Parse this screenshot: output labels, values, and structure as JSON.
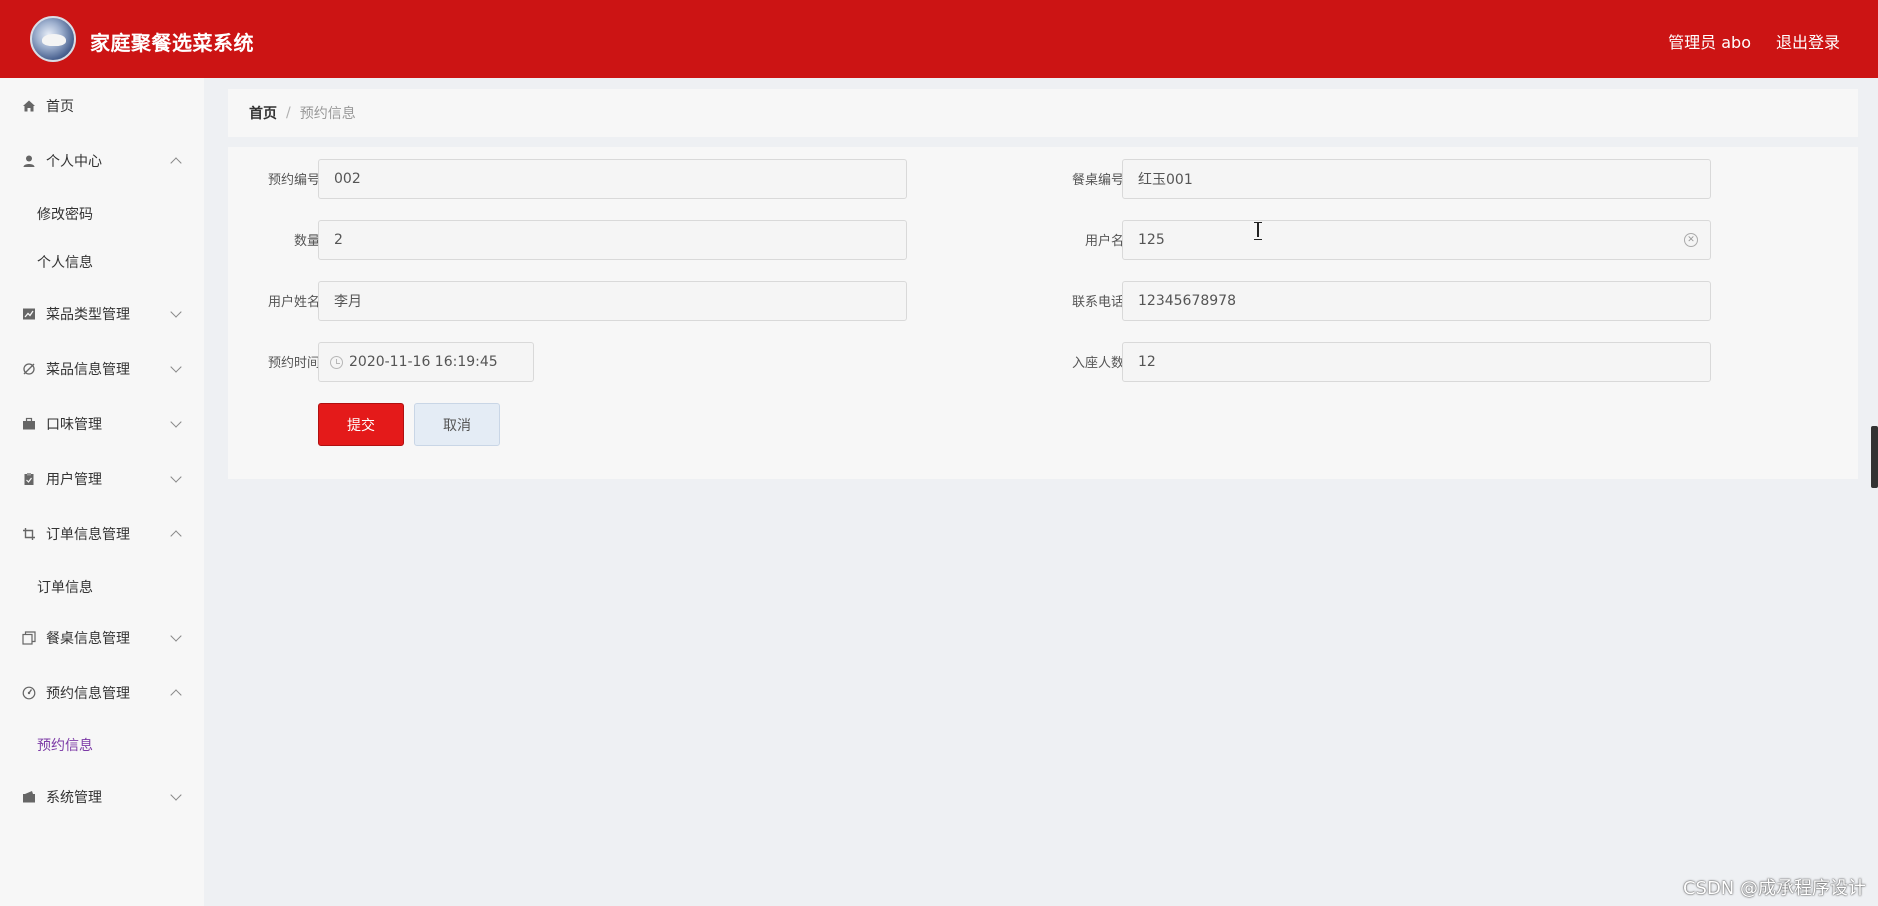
{
  "header": {
    "title": "家庭聚餐选菜系统",
    "admin": "管理员 abo",
    "logout": "退出登录"
  },
  "sidebar": {
    "items": [
      {
        "label": "首页",
        "icon": "home-icon",
        "expanded": null
      },
      {
        "label": "个人中心",
        "icon": "user-icon",
        "expanded": true,
        "children": [
          "修改密码",
          "个人信息"
        ]
      },
      {
        "label": "菜品类型管理",
        "icon": "chart-icon",
        "expanded": false
      },
      {
        "label": "菜品信息管理",
        "icon": "tag-icon",
        "expanded": false
      },
      {
        "label": "口味管理",
        "icon": "briefcase-icon",
        "expanded": false
      },
      {
        "label": "用户管理",
        "icon": "clipboard-icon",
        "expanded": false
      },
      {
        "label": "订单信息管理",
        "icon": "crop-icon",
        "expanded": true,
        "children": [
          "订单信息"
        ]
      },
      {
        "label": "餐桌信息管理",
        "icon": "copy-icon",
        "expanded": false
      },
      {
        "label": "预约信息管理",
        "icon": "gauge-icon",
        "expanded": true,
        "children": [
          "预约信息"
        ]
      },
      {
        "label": "系统管理",
        "icon": "wallet-icon",
        "expanded": false
      }
    ],
    "active_item": "预约信息"
  },
  "breadcrumb": {
    "home": "首页",
    "separator": "/",
    "current": "预约信息"
  },
  "form": {
    "reservation_no": {
      "label": "预约编号",
      "value": "002"
    },
    "table_no": {
      "label": "餐桌编号",
      "value": "红玉001"
    },
    "quantity": {
      "label": "数量",
      "value": "2"
    },
    "username": {
      "label": "用户名",
      "value": "125"
    },
    "user_fullname": {
      "label": "用户姓名",
      "value": "李月"
    },
    "phone": {
      "label": "联系电话",
      "value": "12345678978"
    },
    "reservation_time": {
      "label": "预约时间",
      "value": "2020-11-16 16:19:45"
    },
    "seats": {
      "label": "入座人数",
      "value": "12"
    },
    "submit": "提交",
    "cancel": "取消"
  },
  "watermark": "CSDN @成承程序设计",
  "colors": {
    "header_bg": "#cc1414",
    "submit_bg": "#e41a1a",
    "active_sub": "#7c3aa6"
  }
}
